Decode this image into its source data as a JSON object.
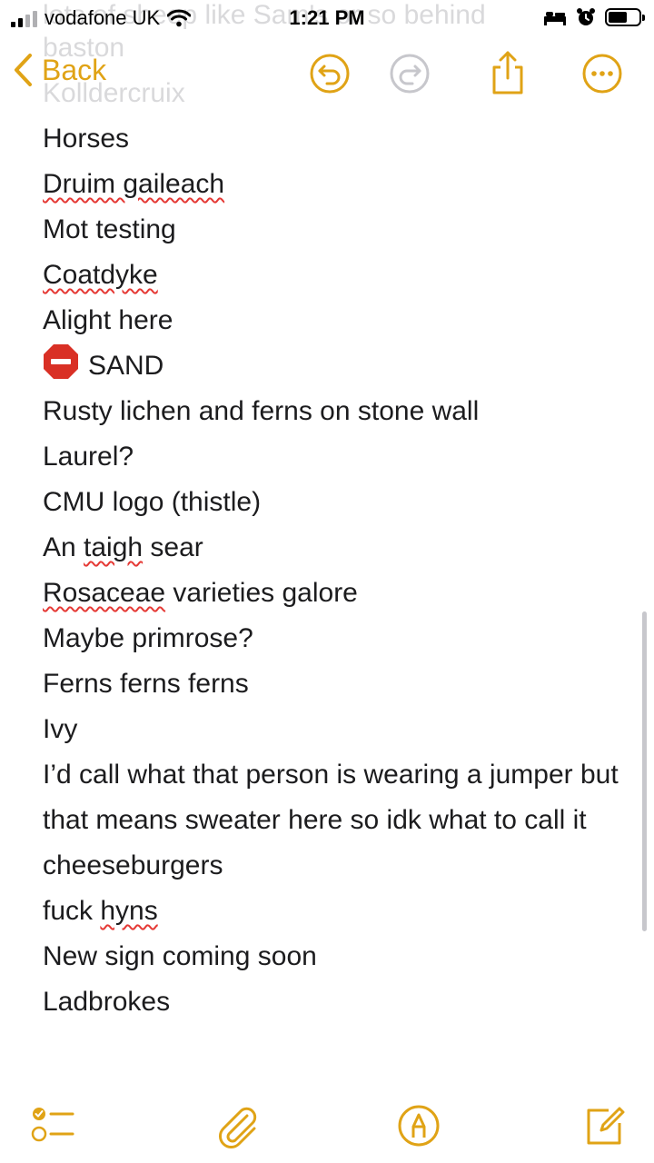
{
  "status_bar": {
    "carrier": "vodafone UK",
    "time": "1:21 PM",
    "icons": [
      "signal-icon",
      "wifi-icon",
      "bed-icon",
      "alarm-icon",
      "battery-icon"
    ]
  },
  "header": {
    "back_label": "Back",
    "scrolled_text": [
      "lots of sheep like Sam's or so behind",
      "baston",
      "Kolldercruix"
    ]
  },
  "note": {
    "lines": [
      "Horses",
      "Druim gaileach",
      "Mot testing",
      "Coatdyke",
      "Alight here",
      "SAND",
      "Rusty lichen and ferns on stone wall",
      "Laurel?",
      "CMU logo (thistle)",
      "An taigh sear",
      "Rosaceae varieties galore",
      "Maybe primrose?",
      "Ferns ferns ferns",
      "Ivy",
      "I’d call what that person is wearing a jumper but that means sweater here so idk what to call it",
      "cheeseburgers",
      "fuck hyns",
      "New sign coming soon",
      "Ladbrokes"
    ],
    "misspelled": [
      "Druim gaileach",
      "Coatdyke",
      "taigh",
      "Rosaceae",
      "hyns"
    ]
  },
  "toolbar": {
    "icons": [
      "checklist-icon",
      "paperclip-icon",
      "markup-pen-icon",
      "compose-icon"
    ]
  },
  "colors": {
    "accent": "#E0A316",
    "text": "#1C1C1E",
    "spellcheck": "#E53935",
    "stop_sign": "#D93025"
  }
}
